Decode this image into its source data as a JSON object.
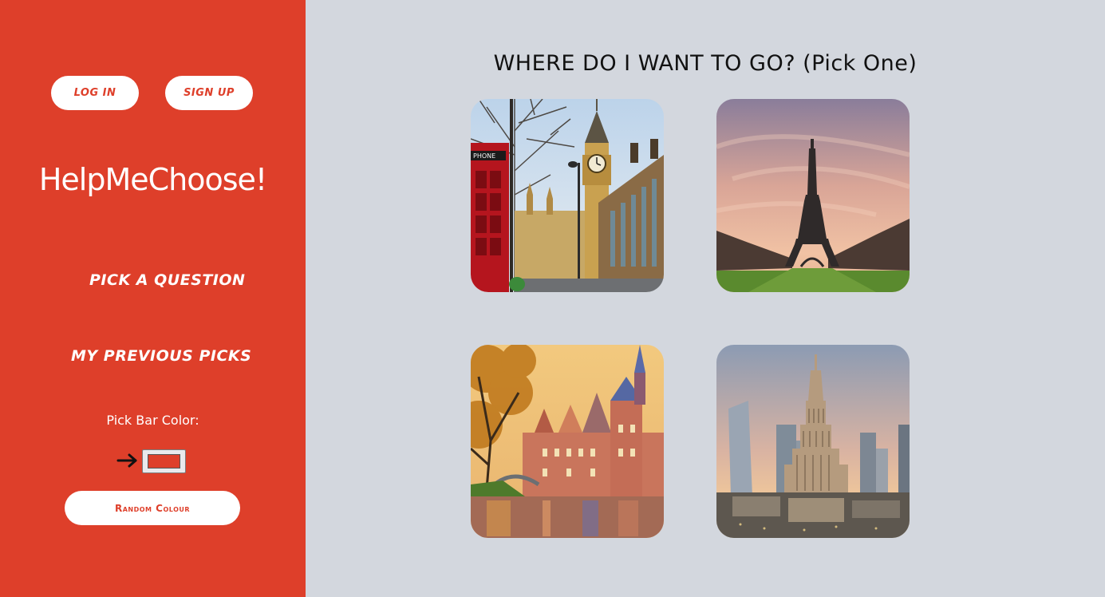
{
  "sidebar": {
    "login_label": "LOG IN",
    "signup_label": "SIGN UP",
    "brand": "HelpMeChoose!",
    "nav": {
      "pick_question": "PICK A QUESTION",
      "previous_picks": "MY PREVIOUS PICKS"
    },
    "color_label": "Pick Bar Color:",
    "random_label": "Random Colour",
    "bar_color": "#de3f2a"
  },
  "main": {
    "title": "WHERE DO I WANT TO GO? (Pick One)",
    "options": [
      {
        "image": "london-big-ben",
        "sign_text": "PHONE"
      },
      {
        "image": "paris-eiffel-tower"
      },
      {
        "image": "bruges-canal"
      },
      {
        "image": "warsaw-palace-of-culture"
      }
    ]
  },
  "colors": {
    "sidebar": "#de3f2a",
    "background": "#d3d7de",
    "button_bg": "#ffffff"
  }
}
